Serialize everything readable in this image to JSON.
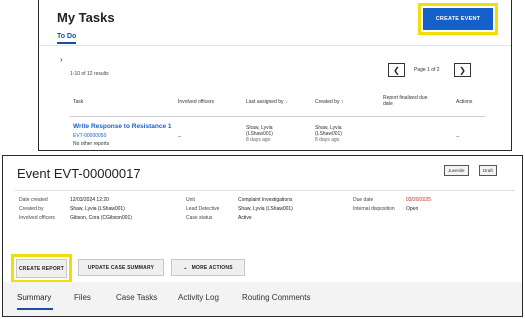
{
  "tasks": {
    "title": "My Tasks",
    "create_event_label": "CREATE EVENT",
    "tab_todo": "To Do",
    "chevron_glyph": "›",
    "results_count": "1-10 of 12 results",
    "pagination": {
      "prev_glyph": "❮",
      "next_glyph": "❯",
      "page_indicator": "Page 1 of 2"
    },
    "columns": {
      "task": "Task",
      "involved_officers": "Involved officers",
      "last_assigned_by": "Last assigned by",
      "sort_arrow": "↓",
      "created_by": "Created by",
      "created_by_sort": "↕",
      "report_finalized_due_date_line1": "Report finalized due",
      "report_finalized_due_date_line2": "date",
      "actions": "Actions"
    },
    "row": {
      "task_title": "Write Response to Resistance 1",
      "event_id": "EVT-00000050",
      "other_reports": "No other reports",
      "involved_officers": "--",
      "last_assigned_name": "Shaw, Lyvia",
      "last_assigned_user": "(LShaw001)",
      "last_assigned_when": "8 days ago",
      "created_by_name": "Shaw, Lyvia",
      "created_by_user": "(LShaw001)",
      "created_by_when": "8 days ago",
      "actions": "--"
    }
  },
  "event": {
    "title": "Event EVT-00000017",
    "badges": {
      "juvenile": "Juvenile",
      "draft": "Draft"
    },
    "meta": {
      "date_created_label": "Date created",
      "date_created_value": "12/03/2024 12:20",
      "created_by_label": "Created by",
      "created_by_value": "Shaw, Lyvia (LShaw001)",
      "involved_officers_label": "Involved officers",
      "involved_officers_value": "Gibson, Cora (CGibson001)",
      "unit_label": "Unit",
      "unit_value": "Complaint Investigations",
      "lead_detective_label": "Lead Detective",
      "lead_detective_value": "Shaw, Lyvia (LShaw001)",
      "case_status_label": "Case status",
      "case_status_value": "Active",
      "due_date_label": "Due date",
      "due_date_value": "03/20/2025",
      "internal_disposition_label": "Internal disposition",
      "internal_disposition_value": "Open"
    },
    "actions": {
      "create_report": "CREATE REPORT",
      "update_case_summary": "UPDATE CASE SUMMARY",
      "more_actions": "MORE ACTIONS",
      "more_actions_glyph": "⌄"
    },
    "tabs": [
      "Summary",
      "Files",
      "Case Tasks",
      "Activity Log",
      "Routing Comments"
    ]
  },
  "colors": {
    "primary_blue": "#1460c8",
    "link_blue": "#1a62c7",
    "highlight_yellow": "#f2dc0a",
    "due_date_red": "#c8262b"
  },
  "icons": [
    "chevron-right-icon",
    "chevron-left-icon",
    "sort-down-icon",
    "chevron-down-icon"
  ]
}
